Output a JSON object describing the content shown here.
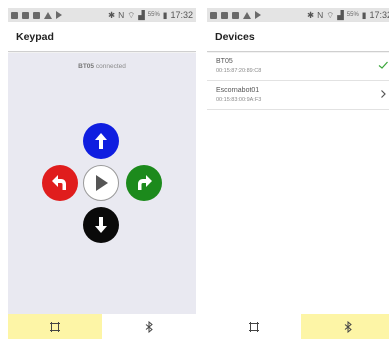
{
  "screens": [
    {
      "statusbar": {
        "battery": "55%",
        "time": "17:32"
      },
      "title": "Keypad",
      "status": {
        "device": "BT05",
        "text": "connected"
      },
      "keypad": {
        "up_icon": "arrow-up-icon",
        "left_icon": "turn-left-icon",
        "play_icon": "play-icon",
        "right_icon": "turn-right-icon",
        "down_icon": "arrow-down-icon",
        "colors": {
          "up": "#0f1ee0",
          "left": "#e01d1d",
          "play": "#ffffff",
          "right": "#1c8a1c",
          "down": "#0a0a0a"
        }
      },
      "nav": [
        {
          "icon": "keypad-icon",
          "active": true
        },
        {
          "icon": "bluetooth-icon",
          "active": false
        }
      ]
    },
    {
      "statusbar": {
        "battery": "55%",
        "time": "17:32"
      },
      "title": "Devices",
      "devices": [
        {
          "name": "BT05",
          "mac": "00:15:87:20:89:C8",
          "icon": "check-icon"
        },
        {
          "name": "Escornabot01",
          "mac": "00:15:83:00:9A:F3",
          "icon": "chevron-right-icon"
        }
      ],
      "nav": [
        {
          "icon": "keypad-icon",
          "active": false
        },
        {
          "icon": "bluetooth-icon",
          "active": true
        }
      ]
    }
  ],
  "colors": {
    "nav_active": "#fdf5a6",
    "content_background": "#e9e9f1",
    "check": "#3aa63a"
  }
}
